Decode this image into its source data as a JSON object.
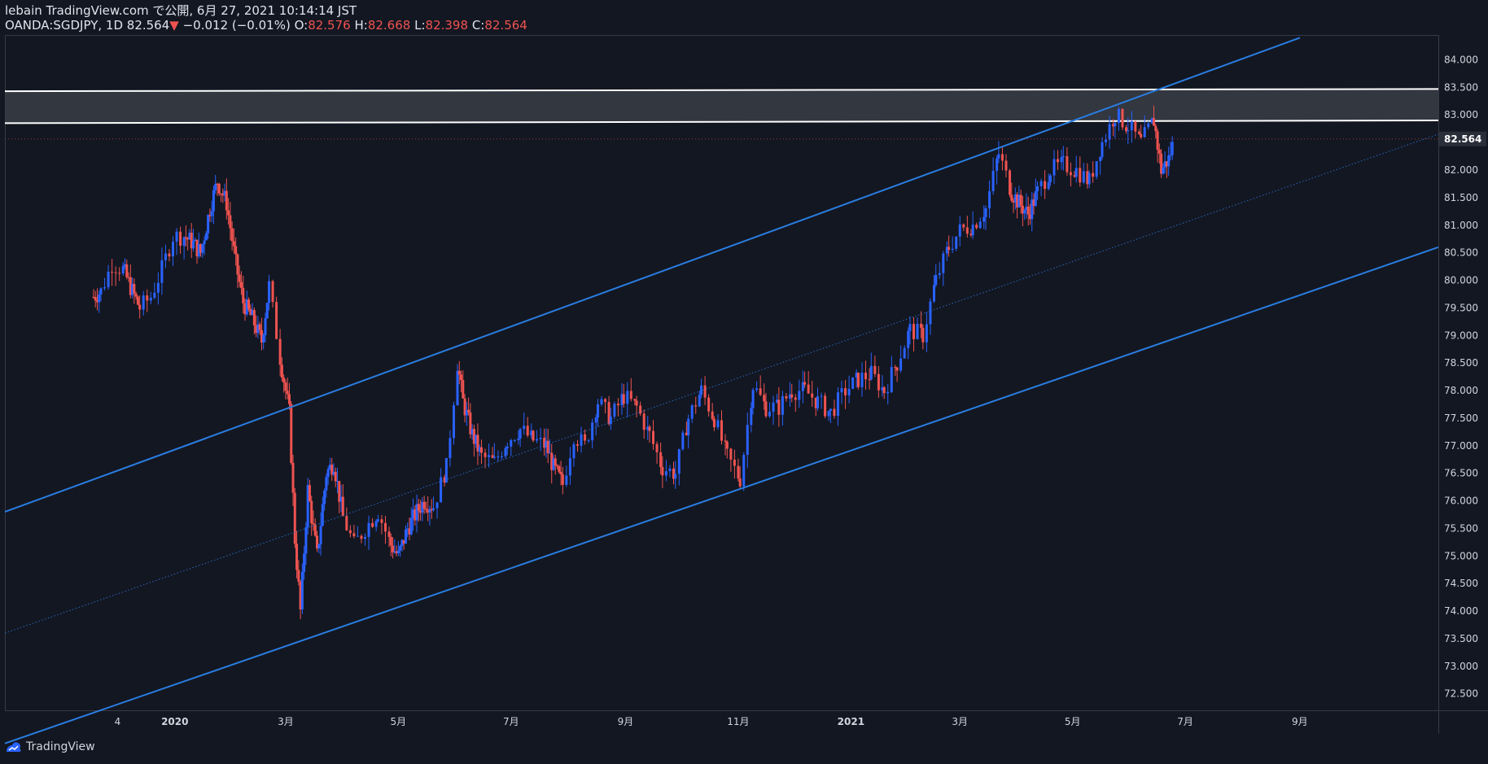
{
  "header": {
    "line1": "lebain TradingView.com で公開, 6月 27, 2021 10:14:14 JST",
    "symbol": "OANDA:SGDJPY, 1D",
    "last": "82.564",
    "arrow": "▼",
    "change": "−0.012 (−0.01%)",
    "o_label": "O:",
    "o_value": "82.576",
    "h_label": "H:",
    "h_value": "82.668",
    "l_label": "L:",
    "l_value": "82.398",
    "c_label": "C:",
    "c_value": "82.564"
  },
  "footer": {
    "brand": "TradingView"
  },
  "colors": {
    "background": "#131722",
    "up": "#2962ff",
    "down": "#ef5350",
    "channel": "#2a7de1",
    "zone": "#3a3d45",
    "zone_line": "#ffffff",
    "axis_text": "#d1d4dc"
  },
  "chart_data": {
    "type": "candlestick",
    "symbol": "OANDA:SGDJPY",
    "interval": "1D",
    "ylim": [
      72.2,
      84.45
    ],
    "price_ticks": [
      "72.500",
      "73.000",
      "73.500",
      "74.000",
      "74.500",
      "75.000",
      "75.500",
      "76.000",
      "76.500",
      "77.000",
      "77.500",
      "78.000",
      "78.500",
      "79.000",
      "79.500",
      "80.000",
      "80.500",
      "81.000",
      "81.500",
      "82.000",
      "82.500",
      "83.000",
      "83.500",
      "84.000"
    ],
    "last_price_label": "82.564",
    "time_ticks": [
      "4",
      "2020",
      "3月",
      "5月",
      "7月",
      "9月",
      "11月",
      "2021",
      "3月",
      "5月",
      "7月",
      "9月"
    ],
    "time_tick_dates": [
      "2019-12-01",
      "2020-01-01",
      "2020-03-01",
      "2020-05-01",
      "2020-07-01",
      "2020-09-01",
      "2020-11-01",
      "2021-01-01",
      "2021-03-01",
      "2021-05-01",
      "2021-07-01",
      "2021-09-01"
    ],
    "close_series": {
      "dates": [
        "2019-11-18",
        "2019-11-22",
        "2019-11-28",
        "2019-12-04",
        "2019-12-09",
        "2019-12-13",
        "2019-12-19",
        "2019-12-25",
        "2019-12-31",
        "2020-01-06",
        "2020-01-10",
        "2020-01-15",
        "2020-01-20",
        "2020-01-24",
        "2020-01-29",
        "2020-02-03",
        "2020-02-07",
        "2020-02-12",
        "2020-02-17",
        "2020-02-21",
        "2020-02-27",
        "2020-03-03",
        "2020-03-06",
        "2020-03-09",
        "2020-03-13",
        "2020-03-18",
        "2020-03-23",
        "2020-03-27",
        "2020-04-01",
        "2020-04-07",
        "2020-04-13",
        "2020-04-20",
        "2020-04-27",
        "2020-05-01",
        "2020-05-06",
        "2020-05-11",
        "2020-05-15",
        "2020-05-20",
        "2020-05-27",
        "2020-06-02",
        "2020-06-05",
        "2020-06-10",
        "2020-06-15",
        "2020-06-22",
        "2020-06-29",
        "2020-07-06",
        "2020-07-13",
        "2020-07-20",
        "2020-07-24",
        "2020-07-29",
        "2020-08-04",
        "2020-08-10",
        "2020-08-17",
        "2020-08-24",
        "2020-08-31",
        "2020-09-07",
        "2020-09-14",
        "2020-09-21",
        "2020-09-28",
        "2020-10-05",
        "2020-10-12",
        "2020-10-19",
        "2020-10-26",
        "2020-11-02",
        "2020-11-09",
        "2020-11-16",
        "2020-11-23",
        "2020-11-30",
        "2020-12-07",
        "2020-12-14",
        "2020-12-21",
        "2020-12-29",
        "2021-01-05",
        "2021-01-12",
        "2021-01-19",
        "2021-01-26",
        "2021-02-02",
        "2021-02-09",
        "2021-02-16",
        "2021-02-23",
        "2021-03-01",
        "2021-03-08",
        "2021-03-15",
        "2021-03-22",
        "2021-03-29",
        "2021-04-02",
        "2021-04-07",
        "2021-04-12",
        "2021-04-19",
        "2021-04-26",
        "2021-05-03",
        "2021-05-10",
        "2021-05-17",
        "2021-05-24",
        "2021-05-31",
        "2021-06-07",
        "2021-06-14",
        "2021-06-18",
        "2021-06-22",
        "2021-06-25"
      ],
      "values": [
        79.7,
        79.8,
        80.3,
        80.2,
        79.8,
        79.5,
        79.7,
        80.2,
        80.8,
        80.8,
        80.7,
        80.5,
        81.3,
        81.8,
        81.4,
        80.3,
        79.6,
        79.3,
        78.9,
        79.9,
        78.6,
        77.6,
        75.3,
        74.0,
        76.2,
        75.0,
        76.5,
        76.7,
        75.7,
        75.2,
        75.5,
        75.8,
        75.2,
        75.0,
        75.5,
        75.8,
        76.0,
        75.9,
        76.6,
        78.5,
        77.8,
        77.2,
        76.8,
        76.7,
        77.1,
        77.3,
        77.1,
        77.0,
        76.6,
        76.3,
        77.2,
        77.0,
        77.8,
        77.5,
        77.9,
        77.7,
        77.2,
        76.6,
        76.5,
        77.5,
        78.0,
        77.5,
        76.8,
        76.4,
        78.1,
        77.7,
        77.7,
        78.0,
        78.0,
        77.8,
        77.6,
        78.0,
        78.2,
        78.3,
        78.0,
        78.5,
        79.1,
        79.0,
        80.0,
        80.6,
        80.9,
        81.0,
        81.3,
        82.3,
        81.6,
        81.4,
        81.2,
        81.6,
        82.0,
        82.1,
        82.0,
        81.8,
        82.5,
        83.0,
        82.8,
        82.5,
        82.9,
        82.0,
        82.2,
        82.564
      ]
    },
    "channel": {
      "upper": [
        {
          "date": "2019-10-01",
          "price": 75.8
        },
        {
          "date": "2021-09-01",
          "price": 84.4
        }
      ],
      "lower": [
        {
          "date": "2019-10-01",
          "price": 71.6
        },
        {
          "date": "2021-11-15",
          "price": 80.6
        }
      ],
      "mid": [
        {
          "date": "2019-10-01",
          "price": 73.6
        },
        {
          "date": "2021-11-15",
          "price": 82.65
        }
      ]
    },
    "resistance_zone": {
      "top": {
        "start": 83.43,
        "end": 83.47
      },
      "bottom": {
        "start": 82.85,
        "end": 82.9
      }
    }
  }
}
